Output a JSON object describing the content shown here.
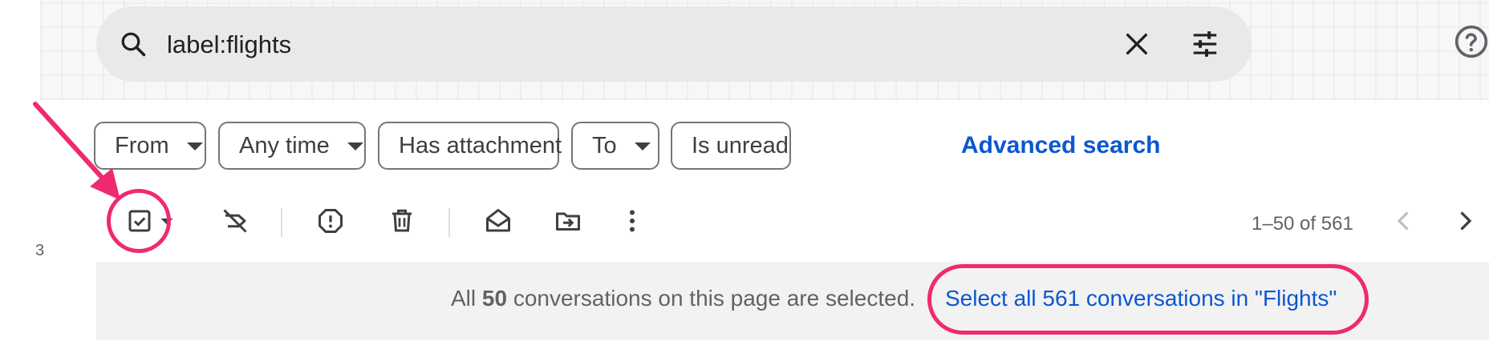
{
  "search": {
    "query": "label:flights",
    "search_icon": "search-icon",
    "clear_icon": "close-icon",
    "options_icon": "tune-icon"
  },
  "header": {
    "help_icon": "help-icon"
  },
  "filters": {
    "chips": [
      {
        "label": "From",
        "has_dropdown": true
      },
      {
        "label": "Any time",
        "has_dropdown": true
      },
      {
        "label": "Has attachment",
        "has_dropdown": false
      },
      {
        "label": "To",
        "has_dropdown": true
      },
      {
        "label": "Is unread",
        "has_dropdown": false
      }
    ],
    "advanced_search": "Advanced search"
  },
  "toolbar": {
    "select_icon": "checkbox-checked-icon",
    "select_dropdown_icon": "caret-down-icon",
    "archive_icon": "label-off-icon",
    "spam_icon": "report-spam-icon",
    "delete_icon": "trash-icon",
    "mark_read_icon": "mark-as-read-icon",
    "move_icon": "move-to-icon",
    "more_icon": "more-vert-icon",
    "pagination": "1–50 of 561",
    "prev_icon": "chevron-left-icon",
    "next_icon": "chevron-right-icon"
  },
  "banner": {
    "prefix": "All ",
    "count": "50",
    "suffix": " conversations on this page are selected.",
    "select_all_link": "Select all 561 conversations in \"Flights\""
  },
  "sidebar_fragment": "3",
  "colors": {
    "accent_link": "#0b57d0",
    "annotation": "#ee2a73",
    "search_bg": "#e9e9e9",
    "banner_bg": "#f2f2f2"
  }
}
